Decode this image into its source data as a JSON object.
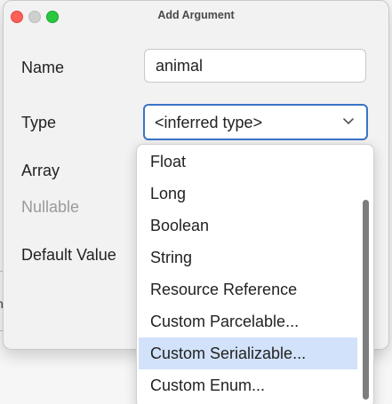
{
  "window": {
    "title": "Add Argument"
  },
  "background": {
    "edge_glyph": "n"
  },
  "form": {
    "name_label": "Name",
    "name_value": "animal",
    "type_label": "Type",
    "type_value": "<inferred type>",
    "array_label": "Array",
    "nullable_label": "Nullable",
    "default_value_label": "Default Value"
  },
  "type_dropdown": {
    "options": [
      "Float",
      "Long",
      "Boolean",
      "String",
      "Resource Reference",
      "Custom Parcelable...",
      "Custom Serializable...",
      "Custom Enum..."
    ],
    "highlighted_option": "Custom Serializable..."
  },
  "colors": {
    "focus_border": "#3b73c7",
    "highlight": "#d2e2fa",
    "close_button": "#ff5f57",
    "zoom_button": "#28c840"
  },
  "icons": {
    "combo_arrow": "chevron-down-icon"
  }
}
